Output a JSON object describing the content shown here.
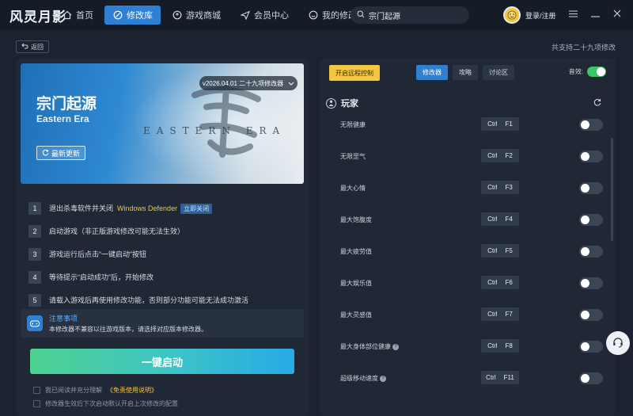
{
  "app": {
    "logo_text": "风灵月影"
  },
  "nav": {
    "items": [
      {
        "label": "首页",
        "icon": "home-icon"
      },
      {
        "label": "修改库",
        "icon": "library-icon",
        "active": true
      },
      {
        "label": "游戏商城",
        "icon": "gamepad-icon"
      },
      {
        "label": "会员中心",
        "icon": "send-icon"
      },
      {
        "label": "我的修改器",
        "icon": "smile-icon"
      }
    ]
  },
  "search": {
    "value": "宗门起源"
  },
  "user": {
    "login_label": "登录/注册"
  },
  "subbar": {
    "back_label": "返回",
    "support_text": "共支持二十九项修改"
  },
  "game": {
    "title": "宗门起源",
    "title_en": "Eastern Era",
    "banner_en_text": "EASTERN ERA",
    "update_label": "最新更新",
    "version": "v2026.04.01 二十九项修改器"
  },
  "steps": [
    {
      "num": "1",
      "text": "退出杀毒软件并关闭",
      "highlight": "Windows Defender",
      "button": "立即关闭"
    },
    {
      "num": "2",
      "text": "启动游戏（非正版游戏修改可能无法生效）"
    },
    {
      "num": "3",
      "text": "游戏运行后点击“一键启动”按钮"
    },
    {
      "num": "4",
      "text": "等待提示“启动成功”后，开始修改"
    },
    {
      "num": "5",
      "text": "请载入游戏后再使用修改功能，否则部分功能可能无法成功激活"
    }
  ],
  "notice": {
    "title": "注意事项",
    "text": "本修改器不兼容以往游戏版本，请选择对应版本修改器。"
  },
  "launch": {
    "label": "一键启动"
  },
  "checks": {
    "agree_prefix": "我已阅读并充分理解",
    "agree_link": "《免责使用说明》",
    "remember": "修改器生效后下次启动默认开启上次修改的配置"
  },
  "right": {
    "remote_label": "开启远程控制",
    "tabs": [
      {
        "label": "修改器",
        "active": true
      },
      {
        "label": "攻略"
      },
      {
        "label": "讨论区"
      }
    ],
    "sound_label": "音效:",
    "section_title": "玩家",
    "features": [
      {
        "name": "无限健康",
        "key": "Ctrl",
        "fkey": "F1",
        "help": false
      },
      {
        "name": "无限罡气",
        "key": "Ctrl",
        "fkey": "F2",
        "help": false
      },
      {
        "name": "最大心情",
        "key": "Ctrl",
        "fkey": "F3",
        "help": false
      },
      {
        "name": "最大饱腹度",
        "key": "Ctrl",
        "fkey": "F4",
        "help": false
      },
      {
        "name": "最大疲劳值",
        "key": "Ctrl",
        "fkey": "F5",
        "help": false
      },
      {
        "name": "最大娱乐值",
        "key": "Ctrl",
        "fkey": "F6",
        "help": false
      },
      {
        "name": "最大灵感值",
        "key": "Ctrl",
        "fkey": "F7",
        "help": false
      },
      {
        "name": "最大身体部位健康",
        "key": "Ctrl",
        "fkey": "F8",
        "help": true
      },
      {
        "name": "超级移动速度",
        "key": "Ctrl",
        "fkey": "F11",
        "help": true
      }
    ]
  },
  "colors": {
    "accent": "#2f7fd3",
    "highlight": "#f2c640",
    "toggle_on": "#3cc46b"
  }
}
